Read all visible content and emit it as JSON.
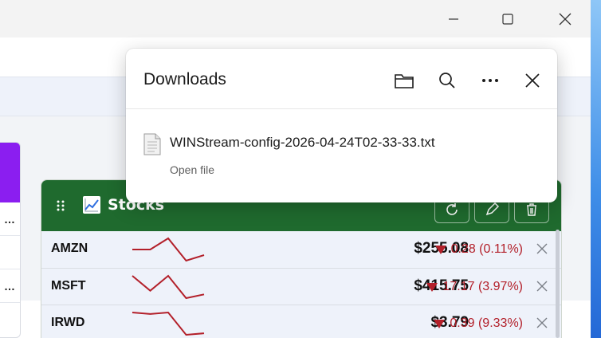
{
  "window": {
    "controls": [
      "minimize",
      "maximize",
      "close"
    ]
  },
  "left_card": {
    "rows": [
      "…",
      "",
      "…"
    ]
  },
  "stocks": {
    "title": "Stocks",
    "header_colour": "#1f6a2e",
    "title_icon": "chart-increasing-icon",
    "header_buttons": [
      "refresh-icon",
      "pencil-icon",
      "trash-icon"
    ],
    "rows": [
      {
        "symbol": "AMZN",
        "price": "$255.08",
        "change": "0.28 (0.11%)",
        "trend": [
          3,
          3,
          1,
          5,
          4
        ]
      },
      {
        "symbol": "MSFT",
        "price": "$415.75",
        "change": "17.17 (3.97%)",
        "trend": [
          1,
          3,
          1,
          4,
          3.5
        ]
      },
      {
        "symbol": "IRWD",
        "price": "$3.79",
        "change": "0.39 (9.33%)",
        "trend": [
          1,
          1.2,
          1,
          4,
          3.8
        ]
      }
    ],
    "down_colour": "#b3202a"
  },
  "downloads": {
    "title": "Downloads",
    "actions": [
      "folder-icon",
      "search-icon",
      "more-icon",
      "close-icon"
    ],
    "file": {
      "name": "WINStream-config-2026-04-24T02-33-33.txt",
      "action": "Open file"
    }
  }
}
